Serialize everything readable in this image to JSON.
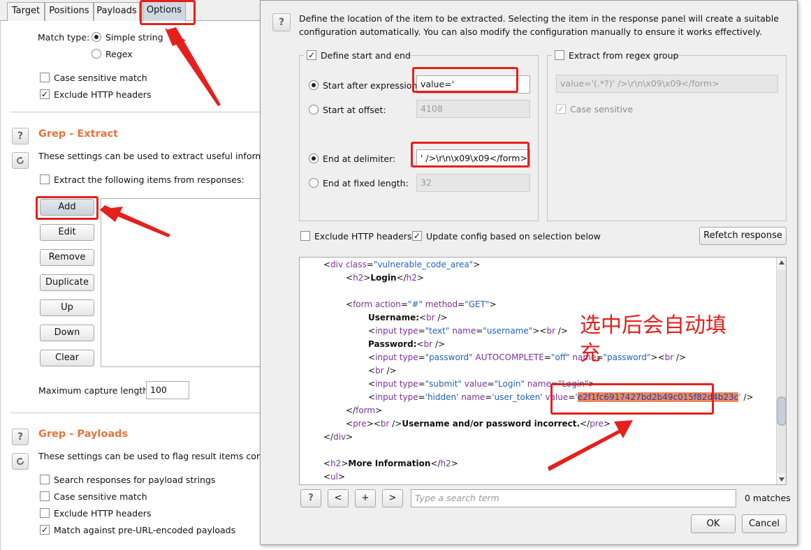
{
  "tabs": [
    {
      "label": "Target"
    },
    {
      "label": "Positions"
    },
    {
      "label": "Payloads"
    },
    {
      "label": "Options"
    }
  ],
  "left": {
    "match_type_label": "Match type:",
    "simple_string": "Simple string",
    "regex": "Regex",
    "case_sensitive": "Case sensitive match",
    "exclude_headers": "Exclude HTTP headers",
    "grep_extract_title": "Grep - Extract",
    "grep_extract_desc": "These settings can be used to extract useful informatio",
    "extract_items": "Extract the following items from responses:",
    "buttons": {
      "add": "Add",
      "edit": "Edit",
      "remove": "Remove",
      "duplicate": "Duplicate",
      "up": "Up",
      "down": "Down",
      "clear": "Clear"
    },
    "max_capture_label": "Maximum capture length:",
    "max_capture_value": "100",
    "grep_payloads_title": "Grep - Payloads",
    "grep_payloads_desc": "These settings can be used to flag result items contain",
    "search_payload": "Search responses for payload strings",
    "case_sensitive2": "Case sensitive match",
    "exclude_headers2": "Exclude HTTP headers",
    "match_preurl": "Match against pre-URL-encoded payloads"
  },
  "dialog": {
    "help_text_1": "Define the location of the item to be extracted. Selecting the item in the response panel will create a suitable",
    "help_text_2": "configuration automatically. You can also modify the configuration manually to ensure it works effectively.",
    "define_start_end": "Define start and end",
    "start_after_label": "Start after expression:",
    "start_after_value": "value='",
    "start_offset_label": "Start at offset:",
    "start_offset_value": "4108",
    "end_delim_label": "End at delimiter:",
    "end_delim_value": "' />\\r\\n\\x09\\x09</form>",
    "end_fixed_label": "End at fixed length:",
    "end_fixed_value": "32",
    "regex_group_label": "Extract from regex group",
    "regex_value": "value='(.*?)' />\\r\\n\\x09\\x09</form>",
    "regex_case": "Case sensitive",
    "exclude_headers": "Exclude HTTP headers",
    "update_config": "Update config based on selection below",
    "refetch": "Refetch response",
    "search_placeholder": "Type a search term",
    "matches": "0 matches",
    "ok": "OK",
    "cancel": "Cancel",
    "nav_help": "?",
    "nav_prev": "<",
    "nav_add": "+",
    "nav_next": ">"
  },
  "code": {
    "l1_tag": "div",
    "l1_attr": "class",
    "l1_val": "\"vulnerable_code_area\"",
    "l2_text": "Login",
    "l3_action_val": "\"#\"",
    "l3_method_val": "\"GET\"",
    "l4_text": "Username:",
    "l5_type": "\"text\"",
    "l5_name": "\"username\"",
    "l6_text": "Password:",
    "l7_type": "\"password\"",
    "l7_auto": "\"off\"",
    "l7_name": "\"password\"",
    "l9_type": "\"submit\"",
    "l9_value": "\"Login\"",
    "l9_name": "\"Login\"",
    "l10_type": "'hidden'",
    "l10_name": "'user_token'",
    "l10_token": "e2f1fc6917427bd2b49c015f82d4b23c",
    "l12_text": "Username and/or password incorrect.",
    "l14_text": "More Information"
  },
  "annotation": {
    "line1": "选中后会自动填",
    "line2": "充"
  },
  "colors": {
    "accent_orange": "#e8733a",
    "annotation_red": "#e5201c",
    "highlight": "#ec8a5c"
  }
}
